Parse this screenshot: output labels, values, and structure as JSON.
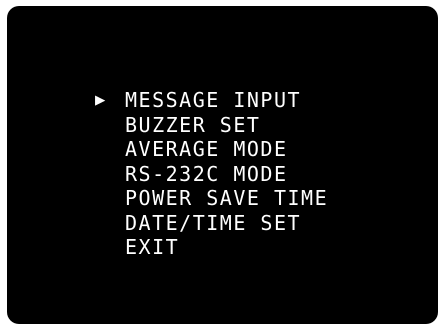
{
  "menu": {
    "cursor_symbol": "▶",
    "items": [
      {
        "label": "MESSAGE INPUT",
        "selected": true
      },
      {
        "label": "BUZZER SET",
        "selected": false
      },
      {
        "label": "AVERAGE MODE",
        "selected": false
      },
      {
        "label": "RS-232C MODE",
        "selected": false
      },
      {
        "label": "POWER SAVE TIME",
        "selected": false
      },
      {
        "label": "DATE/TIME SET",
        "selected": false
      },
      {
        "label": "EXIT",
        "selected": false
      }
    ]
  },
  "colors": {
    "background": "#000000",
    "text": "#ffffff",
    "frame": "#ffffff"
  }
}
